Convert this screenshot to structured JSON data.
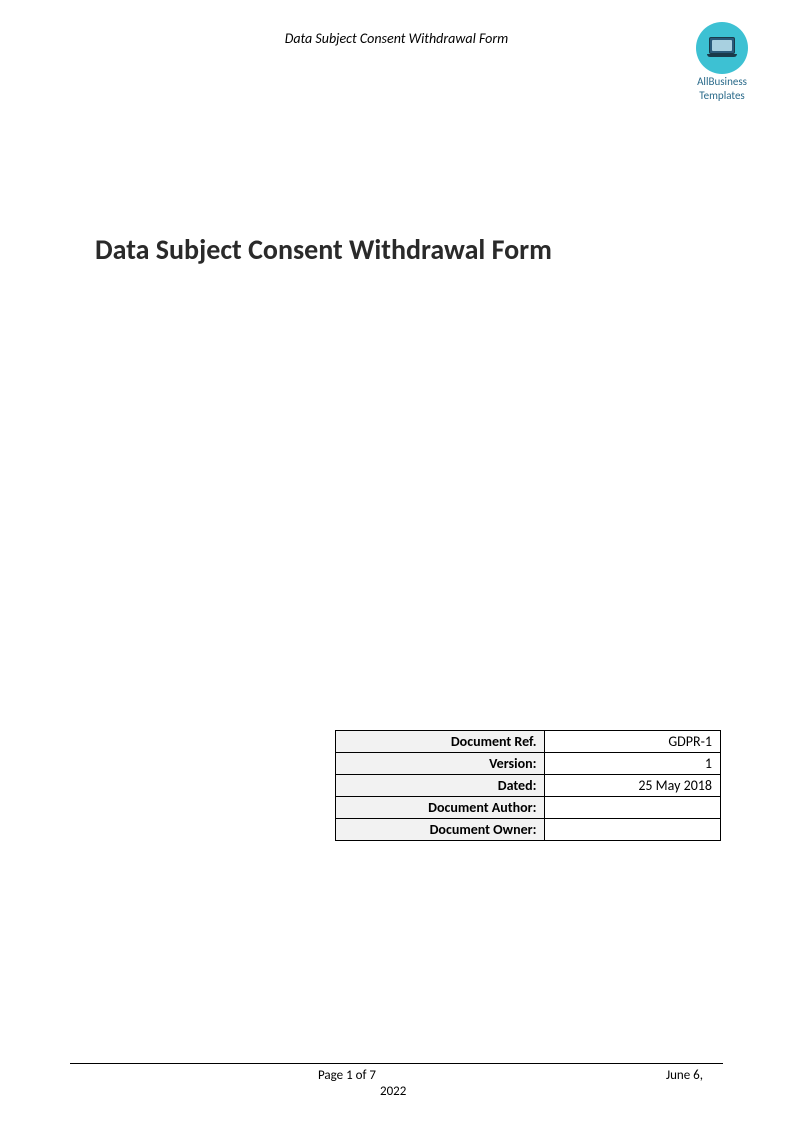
{
  "header": {
    "title": "Data Subject Consent Withdrawal Form",
    "logo": {
      "line1": "AllBusiness",
      "line2": "Templates"
    }
  },
  "title": "Data Subject Consent Withdrawal Form",
  "metadata": {
    "rows": [
      {
        "label": "Document Ref.",
        "value": "GDPR-1"
      },
      {
        "label": "Version:",
        "value": "1"
      },
      {
        "label": "Dated:",
        "value": "25 May 2018"
      },
      {
        "label": "Document Author:",
        "value": ""
      },
      {
        "label": "Document Owner:",
        "value": ""
      }
    ]
  },
  "footer": {
    "page": "Page 1 of 7",
    "date": "June 6,",
    "year": "2022"
  }
}
